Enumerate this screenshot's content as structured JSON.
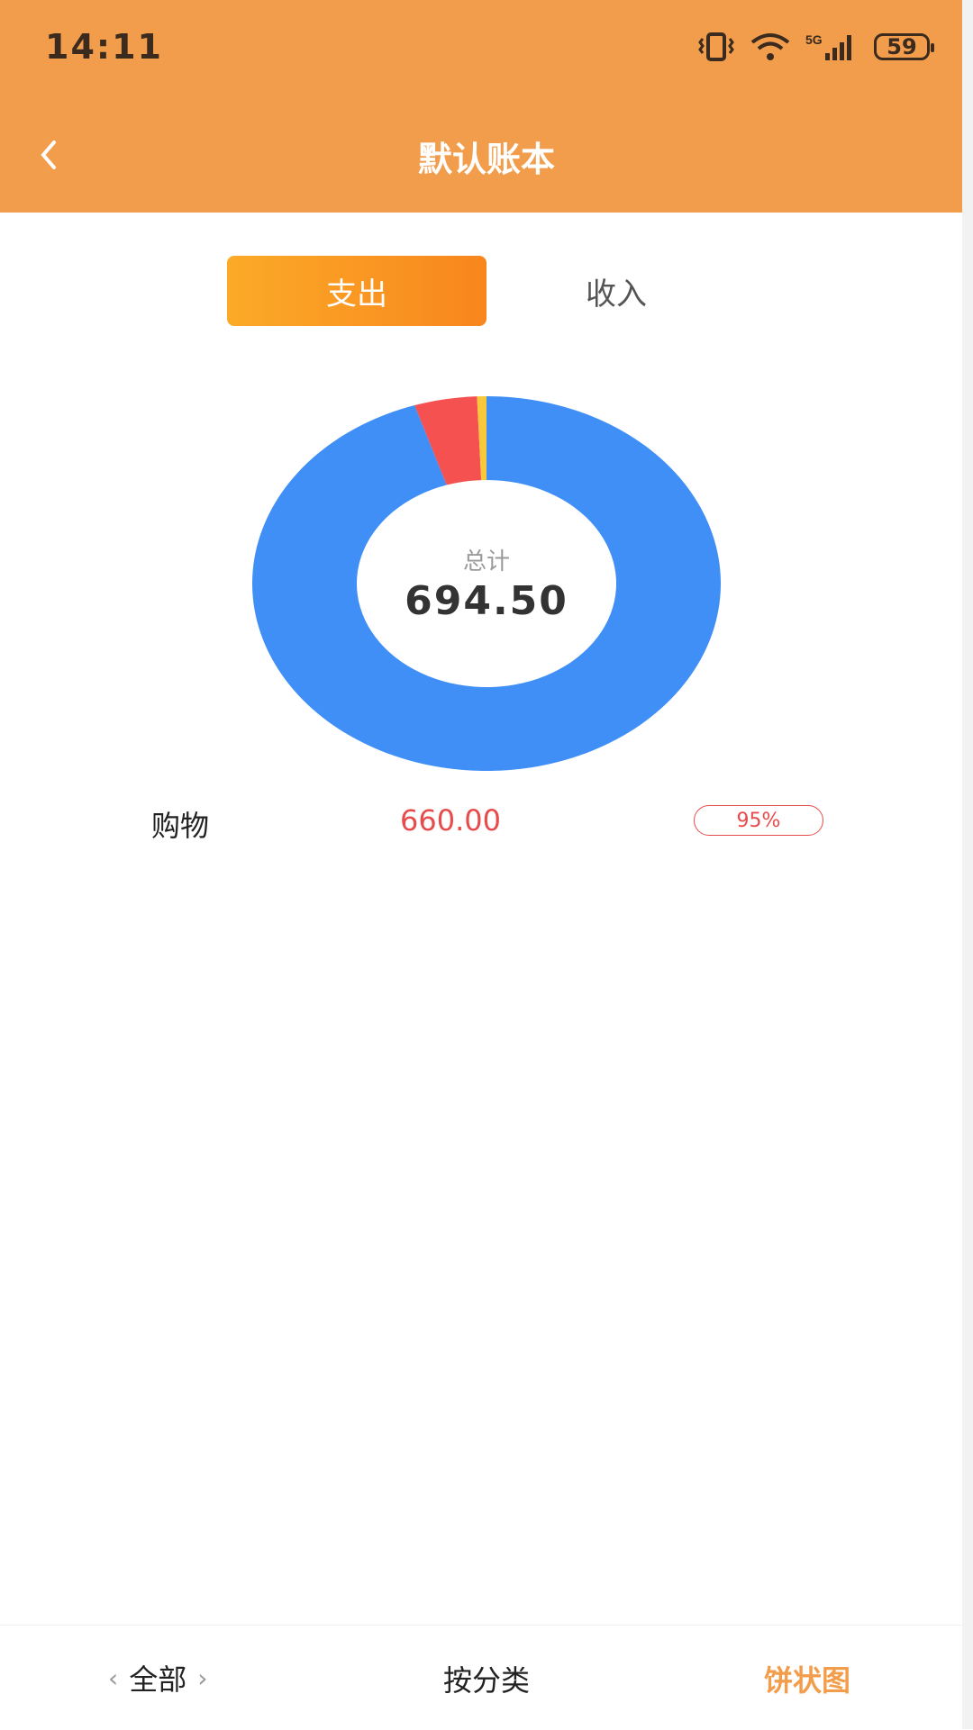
{
  "status": {
    "time": "14:11",
    "battery": "59",
    "network": "5G"
  },
  "header": {
    "title": "默认账本"
  },
  "tabs": {
    "expense": "支出",
    "income": "收入",
    "active": "支出"
  },
  "summary": {
    "label": "总计",
    "total": "694.50"
  },
  "chart_data": {
    "type": "pie",
    "categories": [
      "购物",
      "",
      ""
    ],
    "values": [
      660.0,
      30.0,
      4.5
    ],
    "colors": [
      "#3F8FF7",
      "#F55151",
      "#F7C93A"
    ]
  },
  "categories": [
    {
      "name": "购物",
      "amount": "660.00",
      "percent": "95%"
    }
  ],
  "bottom_bar": {
    "all_label": "全部",
    "by_category": "按分类",
    "pie_chart": "饼状图",
    "prev_symbol": "‹",
    "next_symbol": "›"
  },
  "colors": {
    "header": "#F29D4B",
    "accent": "#F8861D",
    "amount": "#E84B4B"
  }
}
